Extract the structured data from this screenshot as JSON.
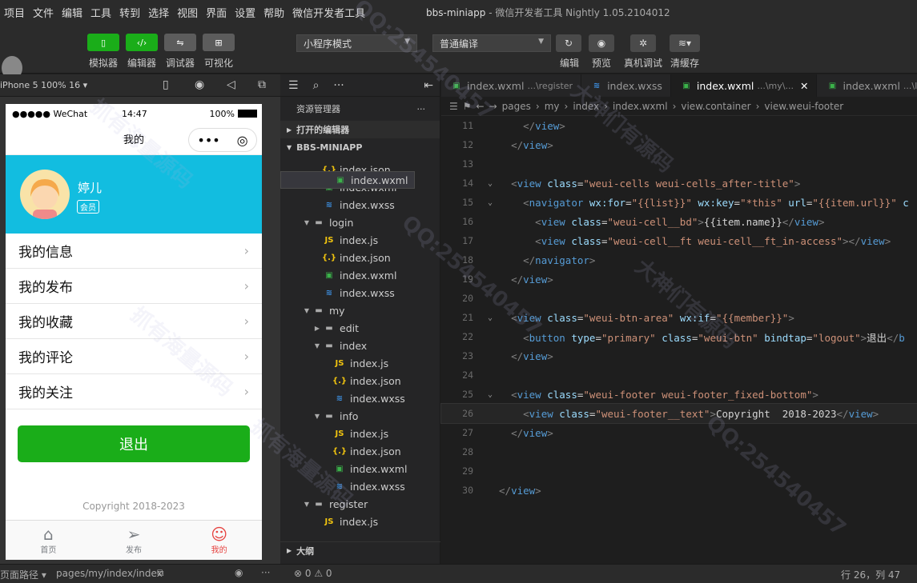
{
  "menubar": {
    "items": [
      "项目",
      "文件",
      "编辑",
      "工具",
      "转到",
      "选择",
      "视图",
      "界面",
      "设置",
      "帮助",
      "微信开发者工具"
    ],
    "project": "bbs-miniapp",
    "title_suffix": "- 微信开发者工具 Nightly 1.05.2104012"
  },
  "toolbar": {
    "simulator": "模拟器",
    "editor": "编辑器",
    "debugger": "调试器",
    "visual": "可视化",
    "mode_select": "小程序模式",
    "compile_select": "普通编译",
    "compile": "编辑",
    "preview": "预览",
    "real_debug": "真机调试",
    "clear_cache": "清缓存"
  },
  "simbar": {
    "device": "iPhone 5 100% 16"
  },
  "phone": {
    "carrier": "●●●●● WeChat",
    "time": "14:47",
    "battery": "100%",
    "nav_title": "我的",
    "user_name": "婷儿",
    "badge": "会员",
    "menu": [
      "我的信息",
      "我的发布",
      "我的收藏",
      "我的评论",
      "我的关注"
    ],
    "logout": "退出",
    "copyright": "Copyright 2018-2023",
    "tabs": [
      {
        "label": "首页",
        "icon": "⌂"
      },
      {
        "label": "发布",
        "icon": "➢"
      },
      {
        "label": "我的",
        "icon": "☺"
      }
    ]
  },
  "explorer": {
    "title": "资源管理器",
    "open_editors": "打开的编辑器",
    "project": "BBS-MINIAPP",
    "outline": "大纲",
    "tree": [
      {
        "label": "index.json",
        "type": "json",
        "depth": 2
      },
      {
        "label": "index.wxml",
        "type": "wxml",
        "depth": 2
      },
      {
        "label": "index.wxss",
        "type": "wxss",
        "depth": 2
      },
      {
        "label": "login",
        "type": "dir",
        "depth": 1,
        "open": true
      },
      {
        "label": "index.js",
        "type": "js",
        "depth": 2
      },
      {
        "label": "index.json",
        "type": "json",
        "depth": 2
      },
      {
        "label": "index.wxml",
        "type": "wxml",
        "depth": 2
      },
      {
        "label": "index.wxss",
        "type": "wxss",
        "depth": 2
      },
      {
        "label": "my",
        "type": "dir",
        "depth": 1,
        "open": true
      },
      {
        "label": "edit",
        "type": "dir",
        "depth": 2,
        "open": false
      },
      {
        "label": "index",
        "type": "dir",
        "depth": 2,
        "open": true
      },
      {
        "label": "index.js",
        "type": "js",
        "depth": 3
      },
      {
        "label": "index.json",
        "type": "json",
        "depth": 3
      },
      {
        "label": "index.wxml",
        "type": "wxml",
        "depth": 3,
        "selected": true
      },
      {
        "label": "index.wxss",
        "type": "wxss",
        "depth": 3
      },
      {
        "label": "info",
        "type": "dir",
        "depth": 2,
        "open": true
      },
      {
        "label": "index.js",
        "type": "js",
        "depth": 3
      },
      {
        "label": "index.json",
        "type": "json",
        "depth": 3
      },
      {
        "label": "index.wxml",
        "type": "wxml",
        "depth": 3
      },
      {
        "label": "index.wxss",
        "type": "wxss",
        "depth": 3
      },
      {
        "label": "register",
        "type": "dir",
        "depth": 1,
        "open": true
      },
      {
        "label": "index.js",
        "type": "js",
        "depth": 2
      }
    ]
  },
  "editor": {
    "tabs": [
      {
        "label": "index.wxml",
        "sub": "...\\register",
        "icon": "wxml"
      },
      {
        "label": "index.wxss",
        "sub": "",
        "icon": "wxss"
      },
      {
        "label": "index.wxml",
        "sub": "...\\my\\...",
        "icon": "wxml",
        "active": true
      },
      {
        "label": "index.wxml",
        "sub": "...\\I",
        "icon": "wxml"
      }
    ],
    "breadcrumb": [
      "pages",
      "my",
      "index",
      "index.wxml",
      "view.container",
      "view.weui-footer"
    ],
    "lines": [
      {
        "n": "11",
        "html": "    <span class='p'>&lt;/</span><span class='t'>view</span><span class='p'>&gt;</span>"
      },
      {
        "n": "12",
        "html": "  <span class='p'>&lt;/</span><span class='t'>view</span><span class='p'>&gt;</span>"
      },
      {
        "n": "13",
        "html": ""
      },
      {
        "n": "14",
        "fold": true,
        "html": "  <span class='p'>&lt;</span><span class='t'>view</span> <span class='a'>class</span><span class='x'>=</span><span class='s'>\"weui-cells weui-cells_after-title\"</span><span class='p'>&gt;</span>"
      },
      {
        "n": "15",
        "fold": true,
        "html": "    <span class='p'>&lt;</span><span class='t'>navigator</span> <span class='a'>wx:for</span><span class='x'>=</span><span class='s'>\"{{list}}\"</span> <span class='a'>wx:key</span><span class='x'>=</span><span class='s'>\"*this\"</span> <span class='a'>url</span><span class='x'>=</span><span class='s'>\"{{item.url}}\"</span> <span class='a'>c</span>"
      },
      {
        "n": "16",
        "html": "      <span class='p'>&lt;</span><span class='t'>view</span> <span class='a'>class</span><span class='x'>=</span><span class='s'>\"weui-cell__bd\"</span><span class='p'>&gt;</span><span class='x'>{{item.name}}</span><span class='p'>&lt;/</span><span class='t'>view</span><span class='p'>&gt;</span>"
      },
      {
        "n": "17",
        "html": "      <span class='p'>&lt;</span><span class='t'>view</span> <span class='a'>class</span><span class='x'>=</span><span class='s'>\"weui-cell__ft weui-cell__ft_in-access\"</span><span class='p'>&gt;&lt;/</span><span class='t'>view</span><span class='p'>&gt;</span>"
      },
      {
        "n": "18",
        "html": "    <span class='p'>&lt;/</span><span class='t'>navigator</span><span class='p'>&gt;</span>"
      },
      {
        "n": "19",
        "html": "  <span class='p'>&lt;/</span><span class='t'>view</span><span class='p'>&gt;</span>"
      },
      {
        "n": "20",
        "html": ""
      },
      {
        "n": "21",
        "fold": true,
        "html": "  <span class='p'>&lt;</span><span class='t'>view</span> <span class='a'>class</span><span class='x'>=</span><span class='s'>\"weui-btn-area\"</span> <span class='a'>wx:if</span><span class='x'>=</span><span class='s'>\"{{member}}\"</span><span class='p'>&gt;</span>"
      },
      {
        "n": "22",
        "html": "    <span class='p'>&lt;</span><span class='t'>button</span> <span class='a'>type</span><span class='x'>=</span><span class='s'>\"primary\"</span> <span class='a'>class</span><span class='x'>=</span><span class='s'>\"weui-btn\"</span> <span class='a'>bindtap</span><span class='x'>=</span><span class='s'>\"logout\"</span><span class='p'>&gt;</span><span class='x'>退出</span><span class='p'>&lt;/</span><span class='t'>b</span>"
      },
      {
        "n": "23",
        "html": "  <span class='p'>&lt;/</span><span class='t'>view</span><span class='p'>&gt;</span>"
      },
      {
        "n": "24",
        "html": ""
      },
      {
        "n": "25",
        "fold": true,
        "html": "  <span class='p'>&lt;</span><span class='t'>view</span> <span class='a'>class</span><span class='x'>=</span><span class='s'>\"weui-footer weui-footer_fixed-bottom\"</span><span class='p'>&gt;</span>"
      },
      {
        "n": "26",
        "cur": true,
        "html": "    <span class='p'>&lt;</span><span class='t'>view</span> <span class='a'>class</span><span class='x'>=</span><span class='s'>\"weui-footer__text\"</span><span class='p'>&gt;</span><span class='x'>Copyright  2018-2023</span><span class='p'>&lt;/</span><span class='t'>view</span><span class='p'>&gt;</span>"
      },
      {
        "n": "27",
        "html": "  <span class='p'>&lt;/</span><span class='t'>view</span><span class='p'>&gt;</span>"
      },
      {
        "n": "28",
        "html": ""
      },
      {
        "n": "29",
        "html": ""
      },
      {
        "n": "30",
        "html": "<span class='p'>&lt;/</span><span class='t'>view</span><span class='p'>&gt;</span>"
      }
    ]
  },
  "statusbar": {
    "path_label": "页面路径",
    "path": "pages/my/index/index",
    "errors": "⊗ 0 ⚠ 0",
    "position": "行 26，列 47"
  },
  "watermarks": [
    "抓有海量源码",
    "QQ:254540457",
    "大神们有源码",
    "抓有海量源码",
    "QQ:254540457",
    "大神们有源码",
    "抓有海量源码",
    "QQ:254540457"
  ]
}
